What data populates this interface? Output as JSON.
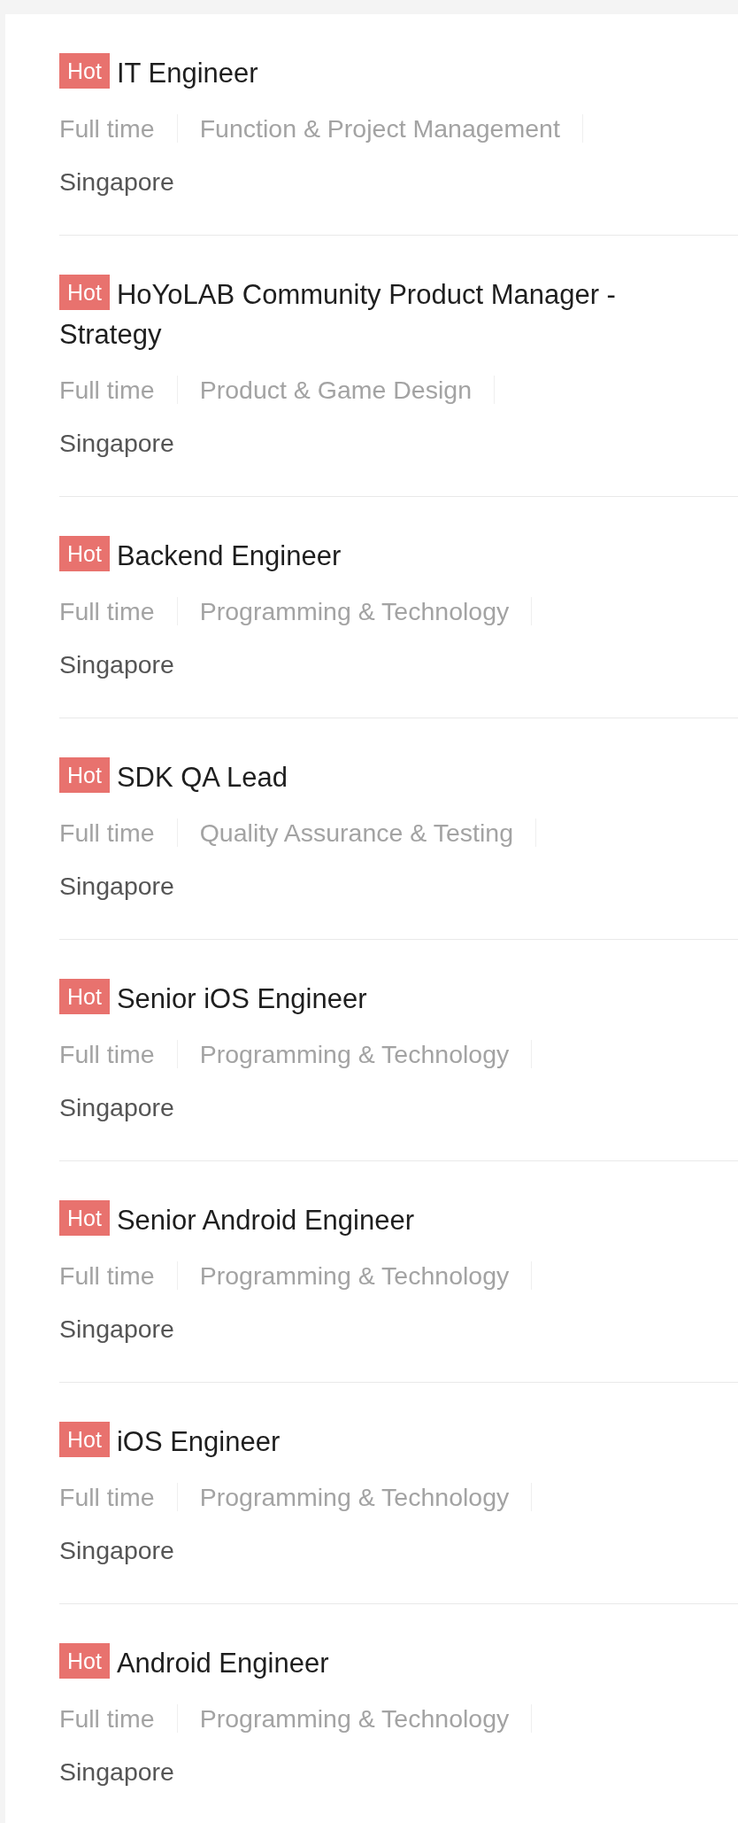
{
  "jobs": [
    {
      "badge": "Hot",
      "title": "IT Engineer",
      "employment_type": "Full time",
      "category": "Function & Project Management",
      "location": "Singapore"
    },
    {
      "badge": "Hot",
      "title": "HoYoLAB Community Product Manager - Strategy",
      "employment_type": "Full time",
      "category": "Product & Game Design",
      "location": "Singapore"
    },
    {
      "badge": "Hot",
      "title": "Backend Engineer",
      "employment_type": "Full time",
      "category": "Programming & Technology",
      "location": "Singapore"
    },
    {
      "badge": "Hot",
      "title": "SDK QA Lead",
      "employment_type": "Full time",
      "category": "Quality Assurance & Testing",
      "location": "Singapore"
    },
    {
      "badge": "Hot",
      "title": "Senior iOS Engineer",
      "employment_type": "Full time",
      "category": "Programming & Technology",
      "location": "Singapore"
    },
    {
      "badge": "Hot",
      "title": "Senior Android Engineer",
      "employment_type": "Full time",
      "category": "Programming & Technology",
      "location": "Singapore"
    },
    {
      "badge": "Hot",
      "title": "iOS Engineer",
      "employment_type": "Full time",
      "category": "Programming & Technology",
      "location": "Singapore"
    },
    {
      "badge": "Hot",
      "title": "Android Engineer",
      "employment_type": "Full time",
      "category": "Programming & Technology",
      "location": "Singapore"
    }
  ]
}
